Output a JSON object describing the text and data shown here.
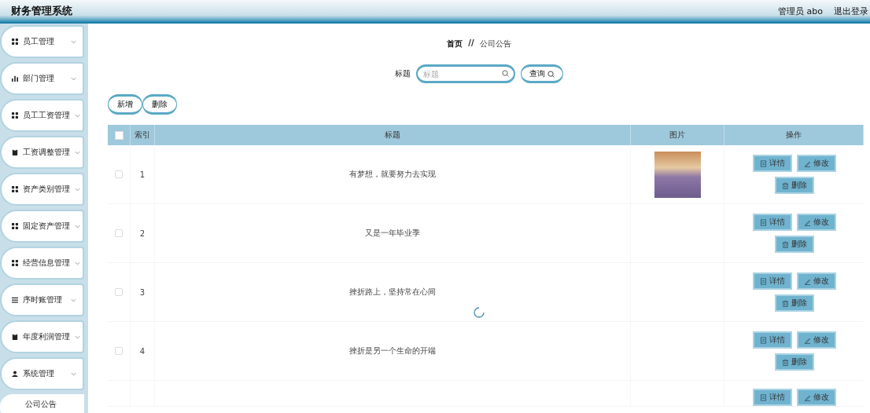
{
  "header": {
    "title": "财务管理系统",
    "user": "管理员 abo",
    "logout": "退出登录"
  },
  "sidebar": {
    "items": [
      {
        "label": "员工管理"
      },
      {
        "label": "部门管理"
      },
      {
        "label": "员工工资管理"
      },
      {
        "label": "工资调整管理"
      },
      {
        "label": "资产类别管理"
      },
      {
        "label": "固定资产管理"
      },
      {
        "label": "经营信息管理"
      },
      {
        "label": "序时账管理"
      },
      {
        "label": "年度利润管理"
      },
      {
        "label": "系统管理",
        "children": [
          {
            "label": "公司公告"
          }
        ]
      }
    ]
  },
  "breadcrumb": {
    "home": "首页",
    "separator": "//",
    "current": "公司公告"
  },
  "search": {
    "label": "标题",
    "placeholder": "标题",
    "button": "查询"
  },
  "actions": [
    "新增",
    "删除"
  ],
  "table": {
    "columns": [
      "索引",
      "标题",
      "图片",
      "操作"
    ],
    "all_checked": false,
    "loading": true,
    "rows": [
      {
        "checked": false,
        "index": "1",
        "title": "有梦想，就要努力去实现",
        "image": true,
        "actions": [
          "详情",
          "修改",
          "删除"
        ]
      },
      {
        "checked": false,
        "index": "2",
        "title": "又是一年毕业季",
        "image": false,
        "actions": [
          "详情",
          "修改",
          "删除"
        ]
      },
      {
        "checked": false,
        "index": "3",
        "title": "挫折路上，坚持常在心间",
        "image": false,
        "actions": [
          "详情",
          "修改",
          "删除"
        ]
      },
      {
        "checked": false,
        "index": "4",
        "title": "挫折是另一个生命的开端",
        "image": false,
        "actions": [
          "详情",
          "修改",
          "删除"
        ]
      },
      {
        "image": false,
        "actions": [
          "详情",
          "修改"
        ]
      }
    ]
  }
}
